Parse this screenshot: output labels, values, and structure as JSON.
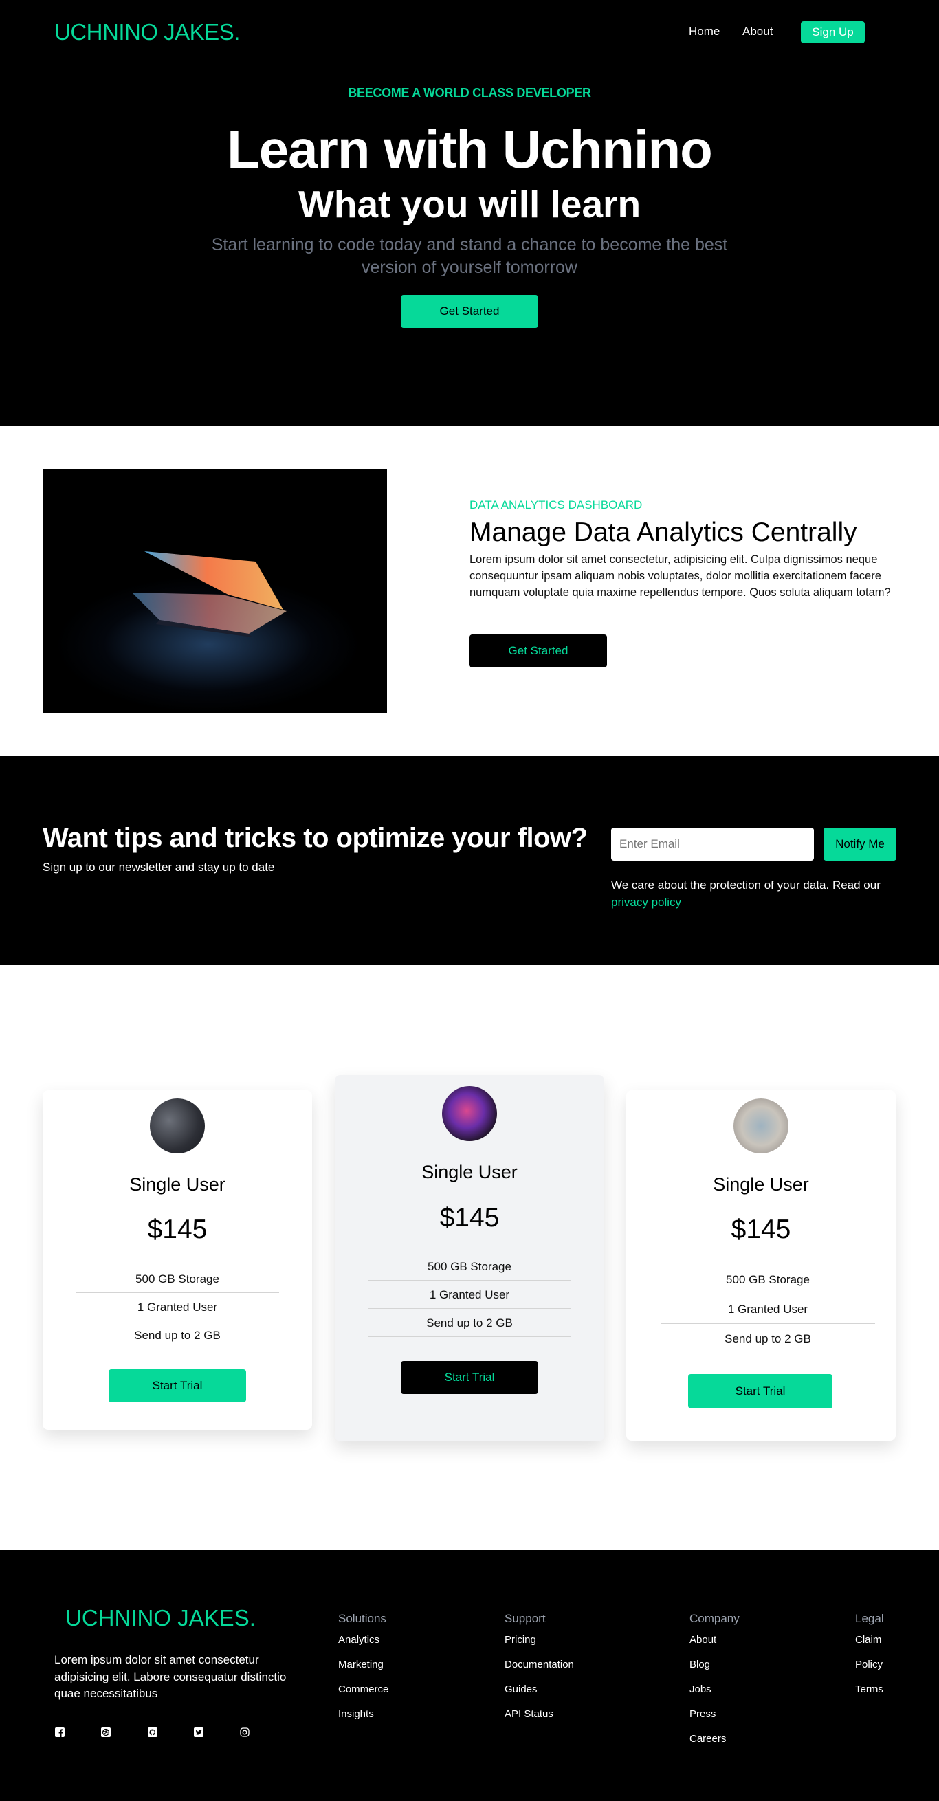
{
  "nav": {
    "logo": "UCHNINO JAKES.",
    "home": "Home",
    "about": "About",
    "signup": "Sign Up"
  },
  "hero": {
    "eyebrow": "BEECOME A WORLD CLASS DEVELOPER",
    "title": "Learn with Uchnino",
    "subtitle": "What you will learn",
    "description": "Start learning to code today and stand a chance to become the best version of yourself tomorrow",
    "cta": "Get Started"
  },
  "feature": {
    "eyebrow": "DATA ANALYTICS DASHBOARD",
    "title": "Manage Data Analytics Centrally",
    "text": "Lorem ipsum dolor sit amet consectetur, adipisicing elit. Culpa dignissimos neque consequuntur ipsam aliquam nobis voluptates, dolor mollitia exercitationem facere numquam voluptate quia maxime repellendus tempore. Quos soluta aliquam totam?",
    "cta": "Get Started"
  },
  "newsletter": {
    "title": "Want tips and tricks to optimize your flow?",
    "subtitle": "Sign up to our newsletter and stay up to date",
    "email_placeholder": "Enter Email",
    "button": "Notify Me",
    "note": "We care about the protection of your data. Read our",
    "privacy_link": "privacy policy"
  },
  "pricing": {
    "cards": [
      {
        "title": "Single User",
        "price": "$145",
        "features": [
          "500 GB Storage",
          "1 Granted User",
          "Send up to 2 GB"
        ],
        "button": "Start Trial"
      },
      {
        "title": "Single User",
        "price": "$145",
        "features": [
          "500 GB Storage",
          "1 Granted User",
          "Send up to 2 GB"
        ],
        "button": "Start Trial"
      },
      {
        "title": "Single User",
        "price": "$145",
        "features": [
          "500 GB Storage",
          "1 Granted User",
          "Send up to 2 GB"
        ],
        "button": "Start Trial"
      }
    ]
  },
  "footer": {
    "logo": "UCHNINO JAKES.",
    "text": "Lorem ipsum dolor sit amet consectetur adipisicing elit. Labore consequatur distinctio quae necessitatibus",
    "social_icons": [
      "facebook-icon",
      "dribbble-icon",
      "github-icon",
      "twitter-icon",
      "instagram-icon"
    ],
    "columns": [
      {
        "title": "Solutions",
        "links": [
          "Analytics",
          "Marketing",
          "Commerce",
          "Insights"
        ]
      },
      {
        "title": "Support",
        "links": [
          "Pricing",
          "Documentation",
          "Guides",
          "API Status"
        ]
      },
      {
        "title": "Company",
        "links": [
          "About",
          "Blog",
          "Jobs",
          "Press",
          "Careers"
        ]
      },
      {
        "title": "Legal",
        "links": [
          "Claim",
          "Policy",
          "Terms"
        ]
      }
    ]
  },
  "colors": {
    "accent": "#06d999",
    "dark": "#000000",
    "muted": "#6b7280"
  }
}
